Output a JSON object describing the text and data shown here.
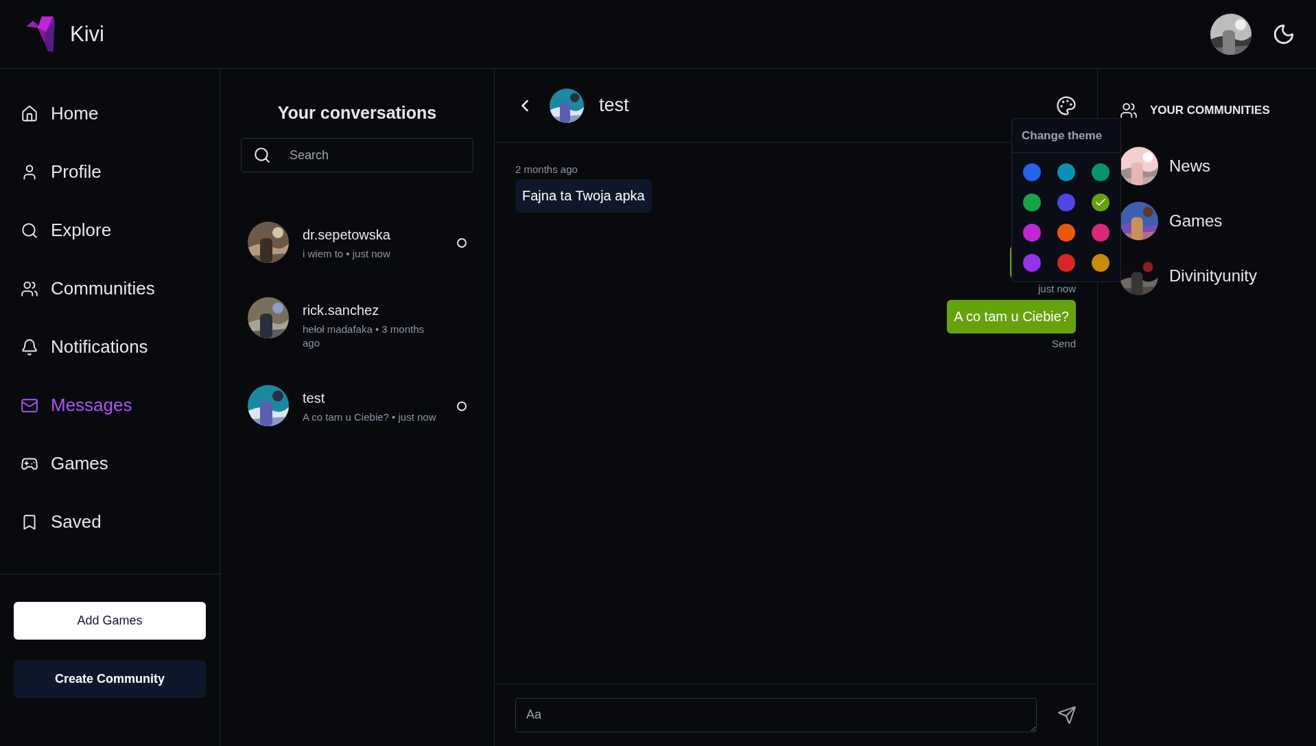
{
  "brand": {
    "name": "Kivi"
  },
  "nav": [
    {
      "label": "Home",
      "selected": false
    },
    {
      "label": "Profile",
      "selected": false
    },
    {
      "label": "Explore",
      "selected": false
    },
    {
      "label": "Communities",
      "selected": false
    },
    {
      "label": "Notifications",
      "selected": false
    },
    {
      "label": "Messages",
      "selected": true
    },
    {
      "label": "Games",
      "selected": false
    },
    {
      "label": "Saved",
      "selected": false
    }
  ],
  "sidebar_buttons": [
    {
      "label": "Add Games",
      "kind": "light"
    },
    {
      "label": "Create Community",
      "kind": "dark"
    }
  ],
  "conversations": {
    "title": "Your conversations",
    "search": {
      "placeholder": "Search"
    },
    "items": [
      {
        "name": "dr.sepetowska",
        "preview": "i wiem to • just now",
        "unread_marker": true
      },
      {
        "name": "rick.sanchez",
        "preview": "hełoł madafaka • 3 months ago",
        "unread_marker": false
      },
      {
        "name": "test",
        "preview": "A co tam u Ciebie?  • just now",
        "unread_marker": true
      }
    ]
  },
  "chat": {
    "name": "test",
    "messages": [
      {
        "kind": "incoming",
        "time": "2 months ago",
        "text": "Fajna ta Twoja apka"
      },
      {
        "kind": "covered",
        "footer": "just now"
      },
      {
        "kind": "outgoing",
        "text": "A co tam u Ciebie?",
        "footer": "Send"
      }
    ],
    "input": {
      "placeholder": "Aa"
    }
  },
  "theme_menu": {
    "title": "Change theme",
    "colors": [
      {
        "color": "#2563eb",
        "selected": false
      },
      {
        "color": "#0891b2",
        "selected": false
      },
      {
        "color": "#059669",
        "selected": false
      },
      {
        "color": "#16a34a",
        "selected": false
      },
      {
        "color": "#4f46e5",
        "selected": false
      },
      {
        "color": "#65a30d",
        "selected": true
      },
      {
        "color": "#c026d3",
        "selected": false
      },
      {
        "color": "#ea580c",
        "selected": false
      },
      {
        "color": "#db2777",
        "selected": false
      },
      {
        "color": "#9333ea",
        "selected": false
      },
      {
        "color": "#dc2626",
        "selected": false
      },
      {
        "color": "#ca8a04",
        "selected": false
      }
    ]
  },
  "communities": {
    "title": "YOUR COMMUNITIES",
    "items": [
      {
        "name": "News"
      },
      {
        "name": "Games"
      },
      {
        "name": "Divinityunity"
      }
    ]
  }
}
